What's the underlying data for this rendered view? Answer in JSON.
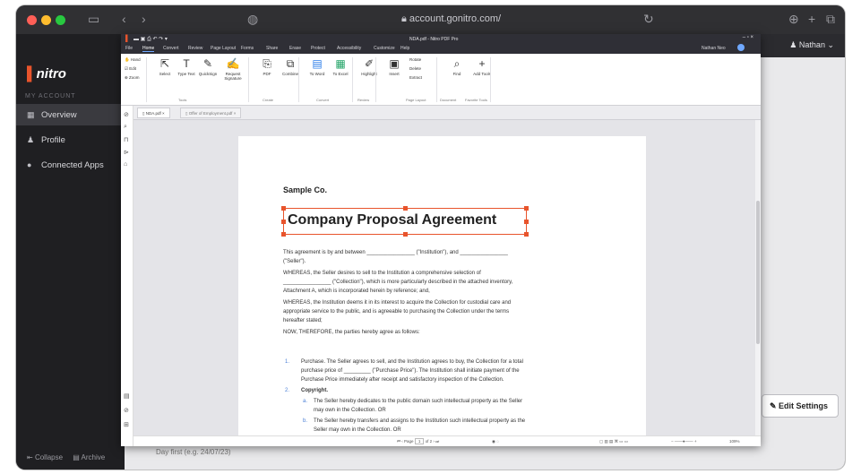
{
  "browser": {
    "url": "account.gonitro.com/"
  },
  "site": {
    "logo": "nitro",
    "section_label": "MY ACCOUNT",
    "nav": [
      {
        "label": "Overview",
        "icon": "grid-icon"
      },
      {
        "label": "Profile",
        "icon": "person-icon"
      },
      {
        "label": "Connected Apps",
        "icon": "dot-icon"
      }
    ],
    "collapse": "Collapse",
    "archive": "Archive",
    "user": "Nathan",
    "edit_settings": "Edit Settings",
    "date_hint": "Day first (e.g. 24/07/23)"
  },
  "app": {
    "title": "NDA.pdf - Nitro PDF Pro",
    "user": "Nathan Neo",
    "menu": [
      "File",
      "Home",
      "Convert",
      "Review",
      "Page Layout",
      "Forms",
      "Share",
      "Erase",
      "Protect",
      "Accessibility",
      "Customize",
      "Help"
    ],
    "active_menu": "Home",
    "ribbon": {
      "left": [
        "Hand",
        "Edit",
        "Zoom"
      ],
      "tools": [
        "Select",
        "Type Text",
        "QuickSign",
        "Request Signature"
      ],
      "create": [
        "PDF",
        "Combine"
      ],
      "convert": [
        "To Word",
        "To Excel"
      ],
      "review": [
        "Highlight"
      ],
      "page": [
        "Insert",
        "Rotate",
        "Delete",
        "Extract"
      ],
      "doc": [
        "Find",
        "Add Tools"
      ],
      "groups": [
        "Tools",
        "Create",
        "Convert",
        "Review",
        "Page Layout",
        "Document",
        "Favorite Tools"
      ]
    },
    "tabs": [
      "NDA.pdf",
      "Offer of Employment.pdf"
    ],
    "status": {
      "page": "1",
      "of": "of 2",
      "zoom": "109%"
    }
  },
  "doc": {
    "company": "Sample Co.",
    "title": "Company Proposal Agreement",
    "lines": [
      "This agreement is by and between ________________ (\"Institution\"), and ________________",
      "(\"Seller\").",
      "WHEREAS, the Seller desires to sell to the Institution a comprehensive selection of",
      "________________ (\"Collection\"), which is more particularly described in the attached inventory,",
      "Attachment A, which is incorporated herein by reference; and,",
      "WHEREAS, the Institution deems it in its interest to acquire the Collection for custodial care and",
      "appropriate service to the public, and is agreeable to purchasing the Collection under the terms",
      "hereafter stated;",
      "NOW, THEREFORE, the parties hereby agree as follows:"
    ],
    "item1": [
      "1.",
      "Purchase. The Seller agrees to sell, and the Institution agrees to buy, the Collection for a total",
      "purchase price of _________ (\"Purchase Price\"). The Institution shall initiate payment of the",
      "Purchase Price immediately after receipt and satisfactory inspection of the Collection."
    ],
    "item2": [
      "2.",
      "Copyright."
    ],
    "item2a": [
      "a.",
      "The Seller hereby dedicates to the public domain such intellectual property as the Seller",
      "may own in the Collection. OR"
    ],
    "item2b": [
      "b.",
      "The Seller hereby transfers and assigns to the Institution such intellectual property as the",
      "Seller may own in the Collection. OR"
    ]
  }
}
